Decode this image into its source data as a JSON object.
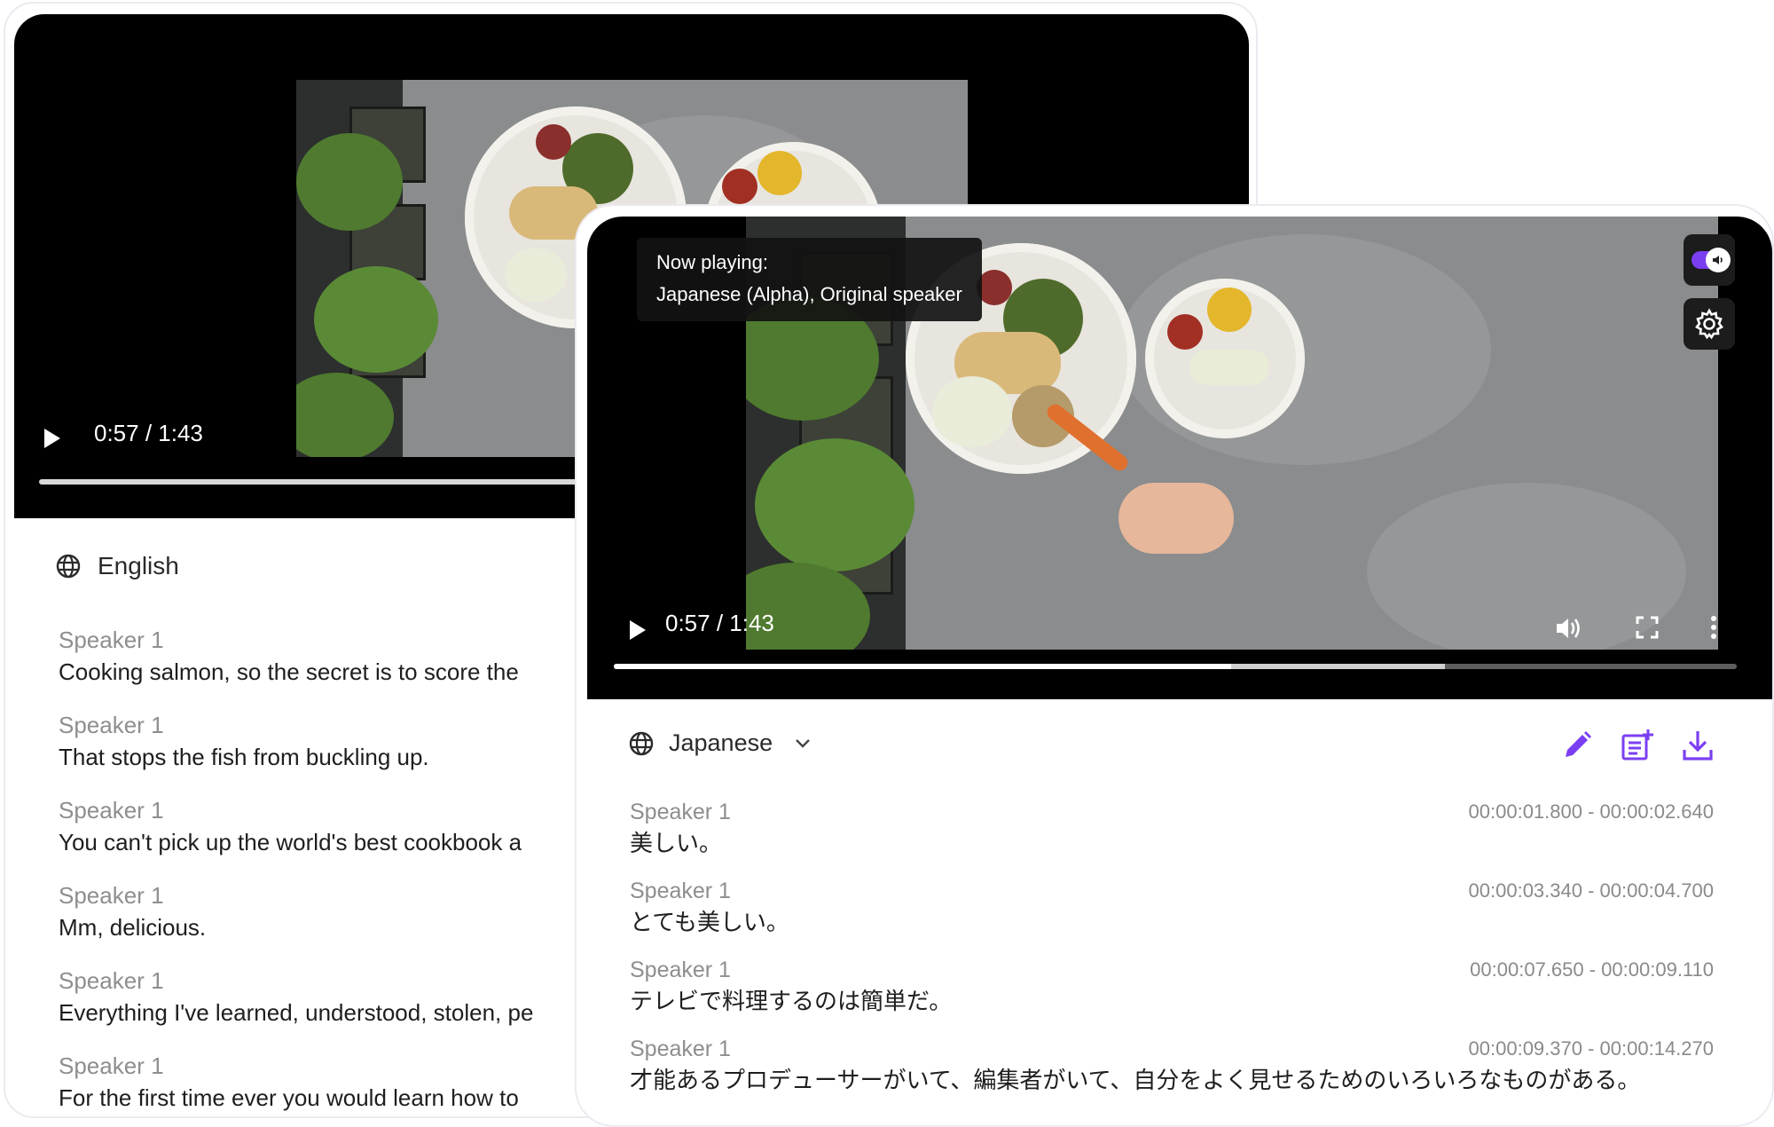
{
  "back_player": {
    "current_time": "0:57",
    "duration": "1:43",
    "time_display": "0:57 / 1:43",
    "progress_fraction": 0.55,
    "language": "English",
    "transcript": [
      {
        "speaker": "Speaker 1",
        "text": "Cooking salmon, so the secret is to score the"
      },
      {
        "speaker": "Speaker 1",
        "text": "That stops the fish from buckling up."
      },
      {
        "speaker": "Speaker 1",
        "text": "You can't pick up the world's best cookbook a"
      },
      {
        "speaker": "Speaker 1",
        "text": "Mm, delicious."
      },
      {
        "speaker": "Speaker 1",
        "text": "Everything I've learned, understood, stolen, pe"
      },
      {
        "speaker": "Speaker 1",
        "text": "For the first time ever you would learn how to"
      }
    ]
  },
  "front_player": {
    "tooltip_line1": "Now playing:",
    "tooltip_line2": "Japanese (Alpha), Original speaker",
    "time_display": "0:57 / 1:43",
    "progress_fraction": 0.55,
    "buffered_fraction": 0.74,
    "audio_toggle_on": true,
    "language": "Japanese",
    "transcript": [
      {
        "speaker": "Speaker 1",
        "range": "00:00:01.800 - 00:00:02.640",
        "text": "美しい。"
      },
      {
        "speaker": "Speaker 1",
        "range": "00:00:03.340 - 00:00:04.700",
        "text": "とても美しい。"
      },
      {
        "speaker": "Speaker 1",
        "range": "00:00:07.650 - 00:00:09.110",
        "text": "テレビで料理するのは簡単だ。"
      },
      {
        "speaker": "Speaker 1",
        "range": "00:00:09.370 - 00:00:14.270",
        "text": "才能あるプロデューサーがいて、編集者がいて、自分をよく見せるためのいろいろなものがある。"
      }
    ]
  },
  "colors": {
    "accent": "#7b3ff2",
    "player_bg": "#000000",
    "speaker_gray": "#8e8e8e"
  },
  "icons": {
    "play": "play-icon",
    "globe": "globe-icon",
    "volume": "volume-icon",
    "fullscreen": "fullscreen-icon",
    "more": "more-vertical-icon",
    "settings": "gear-icon",
    "edit": "pencil-icon",
    "add_note": "add-note-icon",
    "download": "download-icon",
    "chevron": "chevron-down-icon"
  }
}
